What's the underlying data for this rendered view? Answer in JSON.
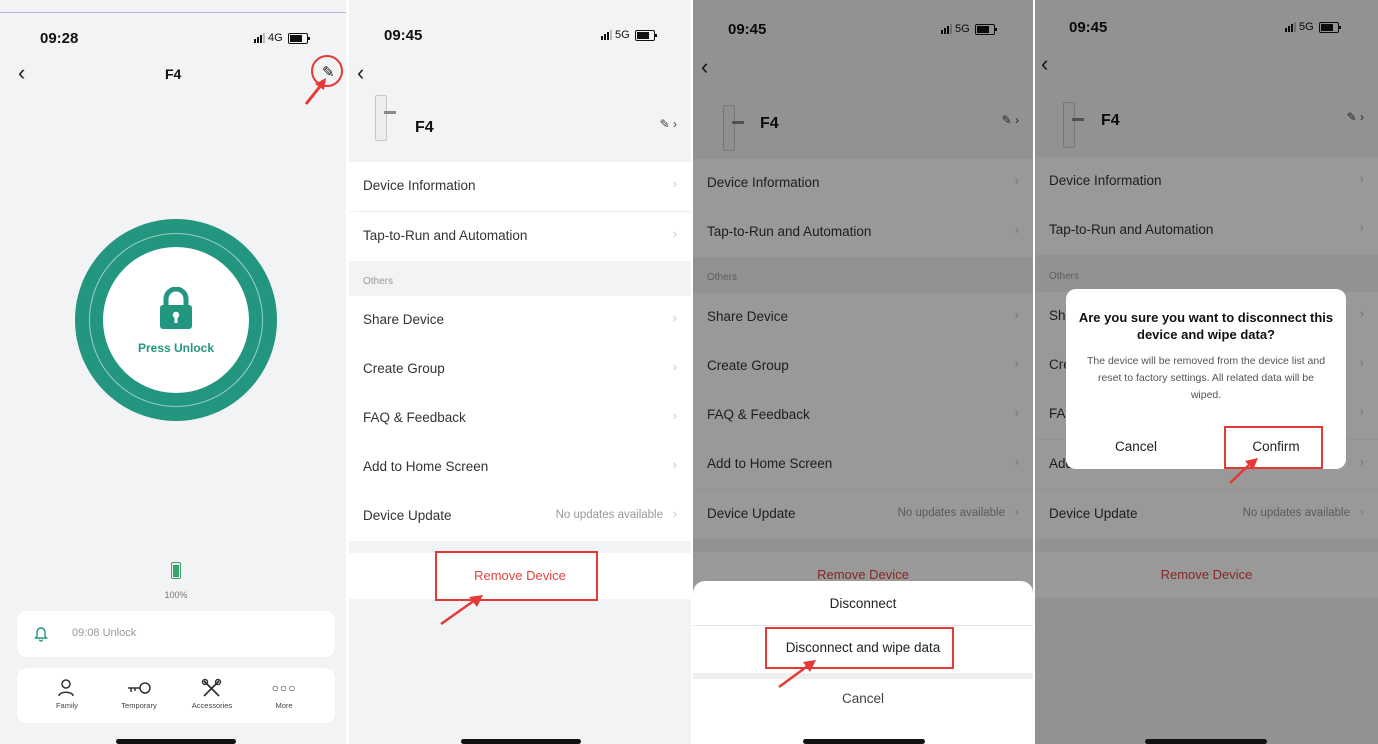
{
  "panel1": {
    "time": "09:28",
    "network": "4G",
    "title": "F4",
    "unlock_label": "Press Unlock",
    "battery_percent": "100%",
    "log_text": "09:08  Unlock",
    "tabs": [
      {
        "label": "Family",
        "icon": "family-icon"
      },
      {
        "label": "Temporary",
        "icon": "key-icon"
      },
      {
        "label": "Accessories",
        "icon": "tools-icon"
      },
      {
        "label": "More",
        "icon": "more-icon"
      }
    ],
    "accent_color": "#23967f"
  },
  "settings": {
    "time": "09:45",
    "network": "5G",
    "device_name": "F4",
    "rows": [
      {
        "label": "Device Information"
      },
      {
        "label": "Tap-to-Run and Automation"
      }
    ],
    "section_others": "Others",
    "others_rows": [
      {
        "label": "Share Device"
      },
      {
        "label": "Create Group"
      },
      {
        "label": "FAQ & Feedback"
      },
      {
        "label": "Add to Home Screen"
      },
      {
        "label": "Device Update",
        "value": "No updates available"
      }
    ],
    "remove_label": "Remove Device",
    "danger_color": "#e0443e"
  },
  "sheet": {
    "disconnect": "Disconnect",
    "disconnect_wipe": "Disconnect and wipe data",
    "cancel": "Cancel"
  },
  "dialog": {
    "title": "Are you sure you want to disconnect this device and wipe data?",
    "message": "The device will be removed from the device list and reset to factory settings. All related data will be wiped.",
    "cancel": "Cancel",
    "confirm": "Confirm"
  }
}
